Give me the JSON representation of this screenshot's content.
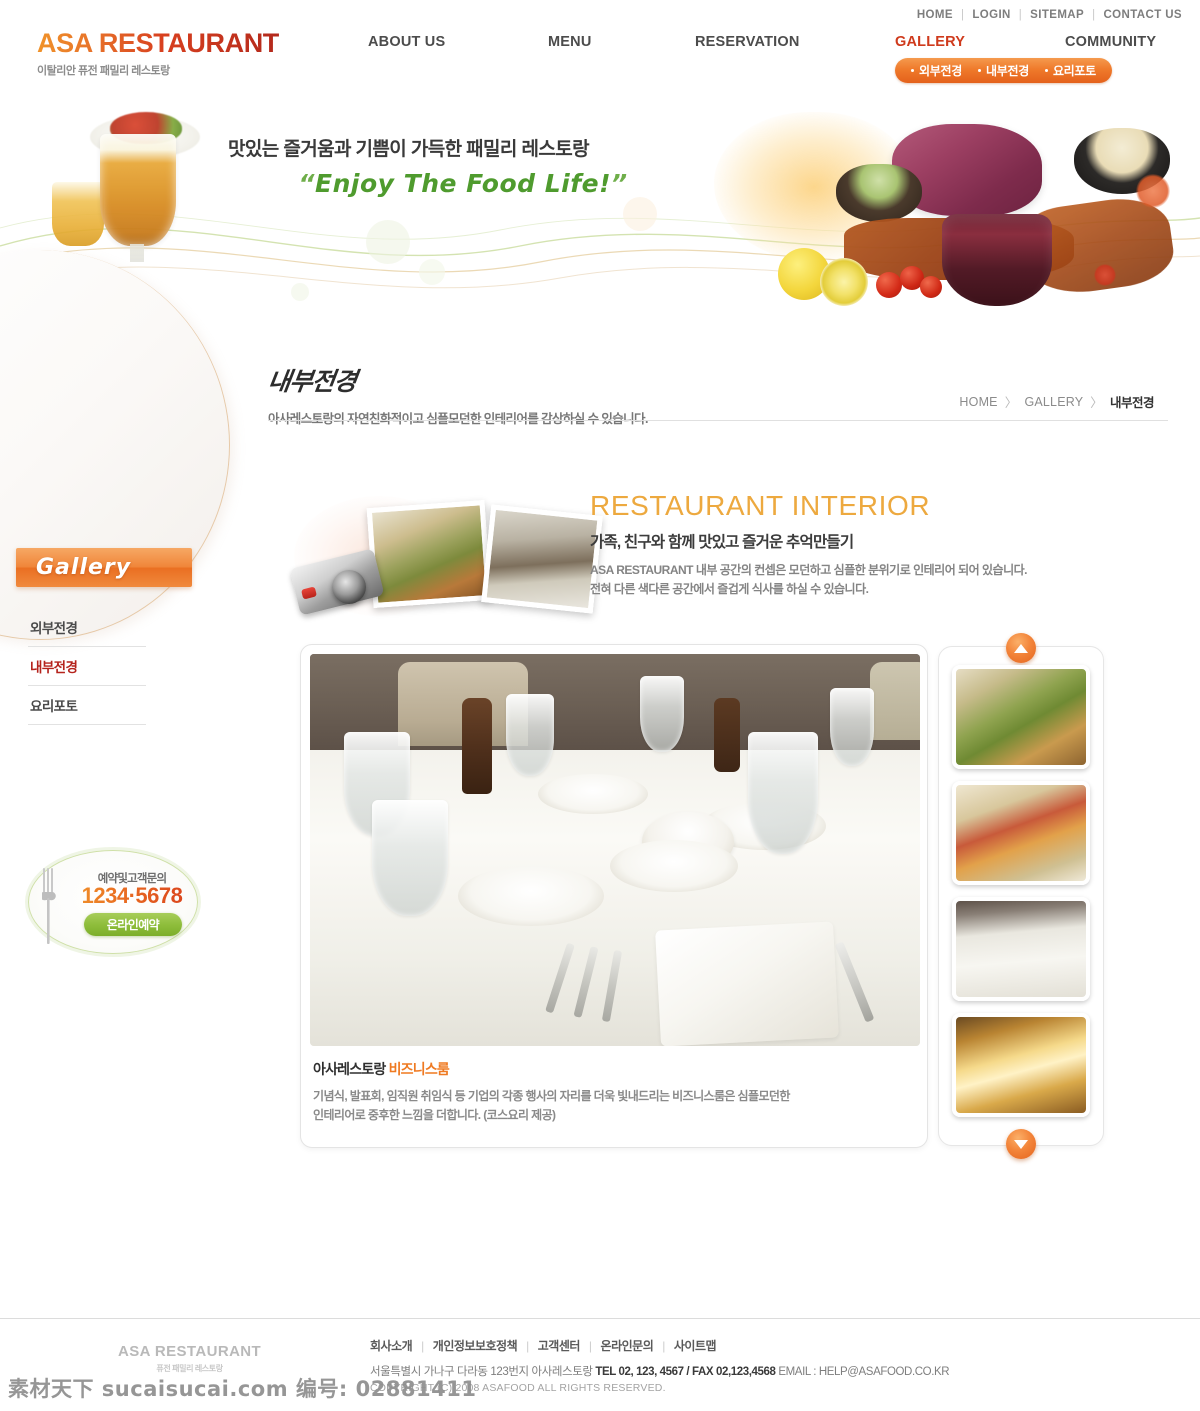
{
  "utility_nav": [
    {
      "label": "HOME"
    },
    {
      "label": "LOGIN"
    },
    {
      "label": "SITEMAP"
    },
    {
      "label": "CONTACT US"
    }
  ],
  "brand": {
    "name": "ASA RESTAURANT",
    "tagline": "이탈리안 퓨전 패밀리 레스토랑"
  },
  "main_nav": [
    {
      "label": "ABOUT US",
      "active": false
    },
    {
      "label": "MENU",
      "active": false
    },
    {
      "label": "RESERVATION",
      "active": false
    },
    {
      "label": "GALLERY",
      "active": true
    },
    {
      "label": "COMMUNITY",
      "active": false
    }
  ],
  "submenu": [
    {
      "label": "외부전경"
    },
    {
      "label": "내부전경"
    },
    {
      "label": "요리포토"
    }
  ],
  "hero": {
    "line1": "맛있는 즐거움과 기쁨이 가득한 패밀리 레스토랑",
    "quote_open": "“",
    "quote_text": "Enjoy The Food Life!",
    "quote_close": "”"
  },
  "sidebar": {
    "tab_label": "Gallery",
    "items": [
      {
        "label": "외부전경",
        "active": false
      },
      {
        "label": "내부전경",
        "active": true
      },
      {
        "label": "요리포토",
        "active": false
      }
    ],
    "reservation": {
      "label": "예약및고객문의",
      "phone": "1234·5678",
      "button": "온라인예약"
    }
  },
  "page_head": {
    "title": "내부전경",
    "desc": "아사레스토랑의 자연친화적이고 심플모던한 인테리어를 감상하실 수 있습니다."
  },
  "breadcrumb": {
    "home": "HOME",
    "sep1": "〉",
    "section": "GALLERY",
    "sep2": "〉",
    "current": "내부전경"
  },
  "content_head": {
    "title": "RESTAURANT INTERIOR",
    "subtitle": "가족, 친구와 함께 맛있고 즐거운 추억만들기",
    "body_line1": "ASA RESTAURANT 내부 공간의 컨셉은 모던하고 심플한 분위기로 인테리어 되어 있습니다.",
    "body_line2": "전혀 다른 색다른 공간에서 즐겁게 식사를 하실 수 있습니다."
  },
  "gallery": {
    "caption_title_main": "아사레스토랑",
    "caption_title_accent": "비즈니스룸",
    "caption_line1": "기념식, 발표회, 임직원 취임식 등 기업의 각종 행사의 자리를 더욱 빛내드리는 비즈니스룸은 심플모던한",
    "caption_line2": "인테리어로 중후한 느낌을 더합니다. (코스요리 제공)",
    "thumbnails": [
      {
        "name": "flower-arrangement-table"
      },
      {
        "name": "buffet-spread"
      },
      {
        "name": "table-setting-closeup"
      },
      {
        "name": "chandelier"
      }
    ],
    "scroll_up": "▲",
    "scroll_down": "▼"
  },
  "footer": {
    "logo_name": "ASA RESTAURANT",
    "logo_sub": "퓨전 패밀리 레스토랑",
    "links": [
      {
        "label": "회사소개"
      },
      {
        "label": "개인정보보호정책"
      },
      {
        "label": "고객센터"
      },
      {
        "label": "온라인문의"
      },
      {
        "label": "사이트맵"
      }
    ],
    "address": "서울특별시 가나구 다라동 123번지 아사레스토랑",
    "tel_fax": "TEL 02, 123, 4567 / FAX 02,123,4568",
    "email": "EMAIL : HELP@ASAFOOD.CO.KR",
    "copyright": "COPYRIGHT (C) 2008 ASAFOOD ALL RIGHTS RESERVED."
  },
  "watermark": {
    "text": "素材天下 sucaisucai.com  编号: 02881411"
  },
  "colors": {
    "accent_orange": "#ef7a22",
    "accent_red": "#cf3a1c",
    "accent_green": "#4f9b2e",
    "title_gold": "#eda93f"
  }
}
